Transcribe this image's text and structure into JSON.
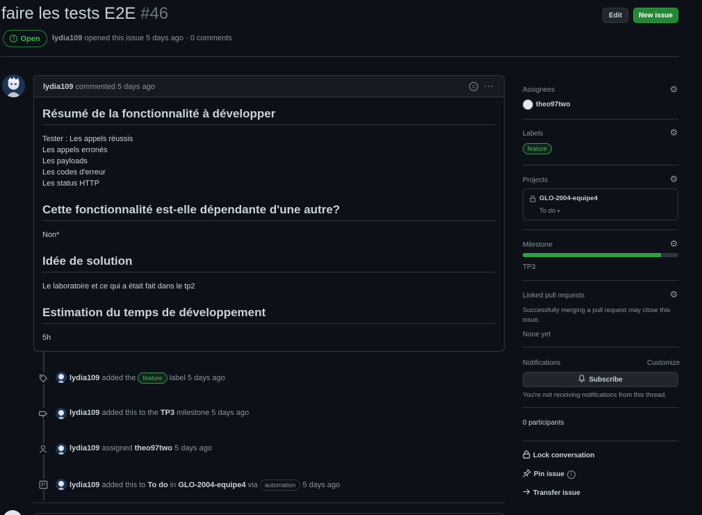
{
  "issue": {
    "title": "faire les tests E2E",
    "number": "#46",
    "state": "Open",
    "author": "lydia109",
    "opened_text": "opened this issue 5 days ago · 0 comments"
  },
  "header": {
    "edit_label": "Edit",
    "new_issue_label": "New issue"
  },
  "comment": {
    "author": "lydia109",
    "action": "commented 5 days ago",
    "heading1": "Résumé de la fonctionnalité à développer",
    "body1_lines": [
      "Tester : Les appels réussis",
      "Les appels erronés",
      "Les payloads",
      "Les codes d'erreur",
      "Les status HTTP"
    ],
    "heading2": "Cette fonctionnalité est-elle dépendante d'une autre?",
    "body2": "Non*",
    "heading3": "Idée de solution",
    "body3": "Le laboratoire et ce qui a était fait dans le tp2",
    "heading4": "Estimation du temps de développement",
    "body4": "5h"
  },
  "timeline": {
    "e1": {
      "actor": "lydia109",
      "pre": "added the",
      "label": "feature",
      "post": "label 5 days ago"
    },
    "e2": {
      "actor": "lydia109",
      "pre": "added this to the",
      "milestone": "TP3",
      "post": "milestone 5 days ago"
    },
    "e3": {
      "actor": "lydia109",
      "pre": "assigned",
      "assignee": "theo97two",
      "post": "5 days ago"
    },
    "e4": {
      "actor": "lydia109",
      "pre": "added this to",
      "column": "To do",
      "mid": "in",
      "project": "GLO-2004-equipe4",
      "via": "via",
      "tag": "automation",
      "post": "5 days ago"
    }
  },
  "sidebar": {
    "assignees_label": "Assignees",
    "assignee": "theo97two",
    "labels_label": "Labels",
    "label": "feature",
    "projects_label": "Projects",
    "project_name": "GLO-2004-equipe4",
    "project_column": "To do",
    "milestone_label": "Milestone",
    "milestone_name": "TP3",
    "milestone_progress": 0.89,
    "linked_label": "Linked pull requests",
    "linked_desc_line1": "Successfully merging a pull request may close this",
    "linked_desc_line2": "issue.",
    "linked_none": "None yet",
    "notifications_label": "Notifications",
    "customize_label": "Customize",
    "subscribe_label": "Subscribe",
    "notif_desc": "You're not receiving notifications from this thread.",
    "participants": "0 participants",
    "lock_label": "Lock conversation",
    "pin_label": "Pin issue",
    "transfer_label": "Transfer issue"
  },
  "colors": {
    "accent_green": "#238636",
    "open_green": "#3fb950",
    "background": "#0d1117",
    "border": "#30363d"
  }
}
